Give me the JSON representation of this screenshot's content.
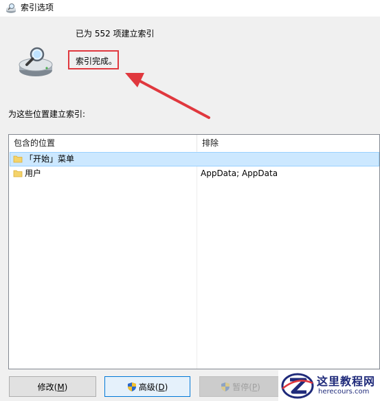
{
  "window": {
    "title": "索引选项"
  },
  "summary": {
    "indexed_count_text": "已为 552 项建立索引",
    "status_text": "索引完成。"
  },
  "locations": {
    "section_label": "为这些位置建立索引:",
    "columns": {
      "included": "包含的位置",
      "excluded": "排除"
    },
    "rows": [
      {
        "location": "「开始」菜单",
        "excluded": "",
        "selected": true
      },
      {
        "location": "用户",
        "excluded": "AppData; AppData",
        "selected": false
      }
    ]
  },
  "buttons": {
    "modify": {
      "label": "修改(",
      "accel": "M",
      "tail": ")"
    },
    "advanced": {
      "label": "高级(",
      "accel": "D",
      "tail": ")"
    },
    "pause": {
      "label": "暂停(",
      "accel": "P",
      "tail": ")",
      "enabled": false
    }
  },
  "watermark": {
    "title": "这里教程网",
    "url": "herecours.com"
  },
  "colors": {
    "highlight_box": "#e0383e",
    "arrow": "#e0383e",
    "selection": "#cce8ff",
    "watermark_text": "#1f2a7a"
  }
}
